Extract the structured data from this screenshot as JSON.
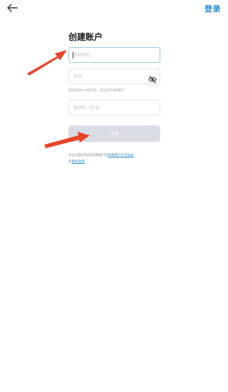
{
  "header": {
    "back_icon": "arrow-left-icon",
    "login_label": "登录"
  },
  "form": {
    "title": "创建账户",
    "email": {
      "placeholder": "邮箱地址",
      "value": ""
    },
    "password": {
      "placeholder": "密码",
      "value": "",
      "visibility_icon": "eye-off-icon"
    },
    "password_hint": "密码须为6-20位字符，且包含字母和数字",
    "invite": {
      "placeholder": "邀请码（可选）",
      "value": ""
    },
    "submit_label": "注册",
    "terms": {
      "prefix": "点击注册代表您同意我们的",
      "user_agreement": "终端用户许可协议",
      "conjunction": "和",
      "privacy_policy": "隐私政策"
    }
  },
  "colors": {
    "accent": "#2a8fd6",
    "submit_disabled": "#d9dbe5",
    "annotation_arrow": "#e8442a"
  }
}
